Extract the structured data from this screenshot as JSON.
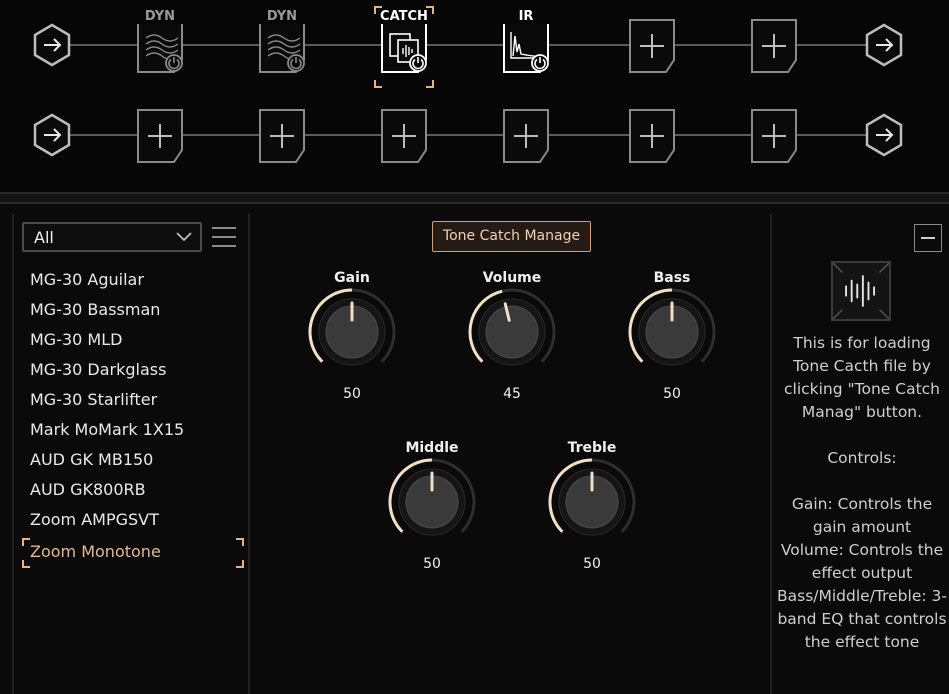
{
  "chain": {
    "row1": {
      "slots": [
        {
          "title": "DYN",
          "type": "dyn",
          "active": false
        },
        {
          "title": "DYN",
          "type": "dyn",
          "active": false
        },
        {
          "title": "CATCH",
          "type": "catch",
          "active": true,
          "selected": true
        },
        {
          "title": "IR",
          "type": "ir",
          "active": true
        },
        {
          "title": "",
          "type": "empty",
          "active": false
        },
        {
          "title": "",
          "type": "empty",
          "active": false
        }
      ]
    },
    "row2": {
      "slots": [
        {
          "title": "",
          "type": "empty"
        },
        {
          "title": "",
          "type": "empty"
        },
        {
          "title": "",
          "type": "empty"
        },
        {
          "title": "",
          "type": "empty"
        },
        {
          "title": "",
          "type": "empty"
        },
        {
          "title": "",
          "type": "empty"
        }
      ]
    },
    "icons": {
      "io": "arrow-right-hexagon-icon",
      "empty": "plus-icon",
      "power": "power-icon"
    }
  },
  "library": {
    "filter": {
      "value": "All",
      "icon": "chevron-down-icon"
    },
    "menu_icon": "hamburger-menu-icon",
    "presets": [
      "MG-30 Aguilar",
      "MG-30 Bassman",
      "MG-30 MLD",
      "MG-30 Darkglass",
      "MG-30 Starlifter",
      "Mark MoMark 1X15",
      "AUD GK MB150",
      "AUD GK800RB",
      "Zoom AMPGSVT",
      "Zoom Monotone"
    ],
    "selected_index": 9
  },
  "editor": {
    "manage_button": "Tone Catch Manage",
    "knobs": [
      {
        "id": "gain",
        "label": "Gain",
        "value": "50",
        "level": 50
      },
      {
        "id": "volume",
        "label": "Volume",
        "value": "45",
        "level": 45
      },
      {
        "id": "bass",
        "label": "Bass",
        "value": "50",
        "level": 50
      },
      {
        "id": "middle",
        "label": "Middle",
        "value": "50",
        "level": 50
      },
      {
        "id": "treble",
        "label": "Treble",
        "value": "50",
        "level": 50
      }
    ]
  },
  "info": {
    "collapse_icon": "minus-icon",
    "thumbnail_icon": "waveform-icon",
    "description": "This is for loading Tone Cacth file by clicking \"Tone Catch Manag\" button.\n\nControls:\n\nGain: Controls the gain amount\nVolume: Controls the effect output\nBass/Middle/Treble: 3-band EQ that controls the effect tone"
  },
  "colors": {
    "accent": "#e8b182",
    "knob_arc": "#f3dfc4",
    "background": "#0a0a0a"
  }
}
